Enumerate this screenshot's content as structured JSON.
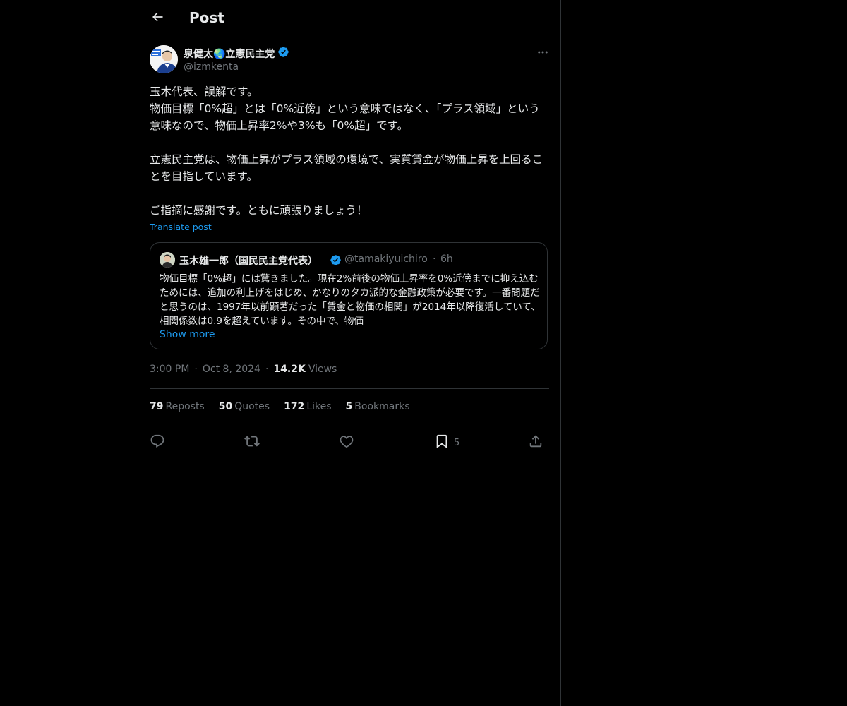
{
  "header": {
    "title": "Post"
  },
  "author": {
    "name": "泉健太🌏立憲民主党",
    "handle": "@izmkenta",
    "avatar_icon": "person-avatar"
  },
  "post": {
    "text": "玉木代表、誤解です。\n物価目標「0%超」とは「0%近傍」という意味ではなく、「プラス領域」という意味なので、物価上昇率2%や3%も「0%超」です。\n\n立憲民主党は、物価上昇がプラス領域の環境で、実質賃金が物価上昇を上回ることを目指しています。\n\nご指摘に感謝です。ともに頑張りましょう！",
    "translate_label": "Translate post"
  },
  "quote": {
    "name": "玉木雄一郎（国民民主党代表）",
    "handle": "@tamakiyuichiro",
    "separator": "·",
    "time": "6h",
    "text": "物価目標「0%超」には驚きました。現在2%前後の物価上昇率を0%近傍までに抑え込むためには、追加の利上げをはじめ、かなりのタカ派的な金融政策が必要です。一番問題だと思うのは、1997年以前顕著だった「賃金と物価の相関」が2014年以降復活していて、相関係数は0.9を超えています。その中で、物価",
    "show_more": "Show more"
  },
  "meta": {
    "time": "3:00 PM",
    "date": "Oct 8, 2024",
    "dot": "·",
    "views_count": "14.2K",
    "views_label": "Views"
  },
  "stats": [
    {
      "count": "79",
      "label": "Reposts"
    },
    {
      "count": "50",
      "label": "Quotes"
    },
    {
      "count": "172",
      "label": "Likes"
    },
    {
      "count": "5",
      "label": "Bookmarks"
    }
  ],
  "actions": {
    "bookmark_count": "5"
  },
  "colors": {
    "background": "#000000",
    "text": "#e7e9ea",
    "muted": "#71767b",
    "accent": "#1d9bf0",
    "border": "#2f3336"
  }
}
